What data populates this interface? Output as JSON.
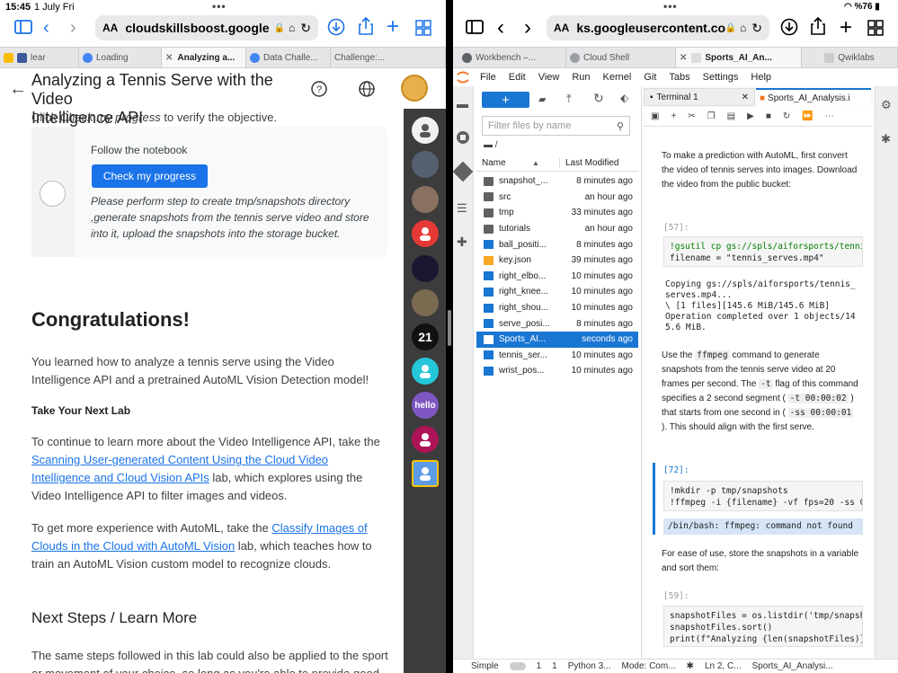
{
  "status": {
    "time": "15:45",
    "date": "1 July Fri",
    "battery": "%76"
  },
  "left": {
    "url": "cloudskillsboost.google",
    "aa": "AA",
    "tabs": [
      "lear",
      "Loading",
      "Analyzing a...",
      "Data Challe...",
      "Challenge:..."
    ],
    "header_title_1": "Analyzing a Tennis Serve with the Video",
    "header_title_2": "Intelligence API",
    "check_progress_line_pre": "Click ",
    "check_progress_line_em": "Check my progress",
    "check_progress_line_post": " to verify the objective.",
    "card_title": "Follow the notebook",
    "check_btn": "Check my progress",
    "card_instructions": "Please perform step to create tmp/snapshots directory ,generate snapshots from the tennis serve video and store into it, upload the snapshots into the storage bucket.",
    "congrats": "Congratulations!",
    "congrats_text": "You learned how to analyze a tennis serve using the Video Intelligence API and a pretrained AutoML Vision Detection model!",
    "next_lab_heading": "Take Your Next Lab",
    "next_lab_pre": "To continue to learn more about the Video Intelligence API, take the ",
    "next_lab_link": "Scanning User-generated Content Using the Cloud Video Intelligence and Cloud Vision APIs",
    "next_lab_post": " lab, which explores using the Video Intelligence API to filter images and videos.",
    "automl_pre": "To get more experience with AutoML, take the ",
    "automl_link": "Classify Images of Clouds in the Cloud with AutoML Vision",
    "automl_post": " lab, which teaches how to train an AutoML Vision custom model to recognize clouds.",
    "next_steps": "Next Steps / Learn More",
    "next_steps_text": "The same steps followed in this lab could also be applied to the sport or movement of your choice, so long as you're able to provide good video",
    "avatar_labels": [
      "21",
      "hello"
    ]
  },
  "right": {
    "url": "ks.googleusercontent.com",
    "aa": "AA",
    "tabs": [
      "Workbench –...",
      "Cloud Shell",
      "Sports_AI_An...",
      "Qwiklabs"
    ],
    "menu": [
      "File",
      "Edit",
      "View",
      "Run",
      "Kernel",
      "Git",
      "Tabs",
      "Settings",
      "Help"
    ],
    "filter_placeholder": "Filter files by name",
    "path": "/",
    "col_name": "Name",
    "col_modified": "Last Modified",
    "files": [
      {
        "name": "snapshot_...",
        "time": "8 minutes ago",
        "type": "folder"
      },
      {
        "name": "src",
        "time": "an hour ago",
        "type": "folder"
      },
      {
        "name": "tmp",
        "time": "33 minutes ago",
        "type": "folder"
      },
      {
        "name": "tutorials",
        "time": "an hour ago",
        "type": "folder"
      },
      {
        "name": "ball_positi...",
        "time": "8 minutes ago",
        "type": "image"
      },
      {
        "name": "key.json",
        "time": "39 minutes ago",
        "type": "json"
      },
      {
        "name": "right_elbo...",
        "time": "10 minutes ago",
        "type": "image"
      },
      {
        "name": "right_knee...",
        "time": "10 minutes ago",
        "type": "image"
      },
      {
        "name": "right_shou...",
        "time": "10 minutes ago",
        "type": "image"
      },
      {
        "name": "serve_posi...",
        "time": "8 minutes ago",
        "type": "image"
      },
      {
        "name": "Sports_AI...",
        "time": "seconds ago",
        "type": "notebook"
      },
      {
        "name": "tennis_ser...",
        "time": "10 minutes ago",
        "type": "image"
      },
      {
        "name": "wrist_pos...",
        "time": "10 minutes ago",
        "type": "image"
      }
    ],
    "selected_file": "Sports_AI...",
    "doc_tabs": [
      "Terminal 1",
      "Sports_AI_Analysis.i"
    ],
    "p1": "To make a prediction with AutoML, first convert the video of tennis serves into images. Download the video from the public bucket:",
    "cell57": "[57]:",
    "code57_1": "!gsutil cp gs://spls/aiforsports/tennis_",
    "code57_2": "filename = \"tennis_serves.mp4\"",
    "out57": "Copying gs://spls/aiforsports/tennis_\nserves.mp4...\n\\ [1 files][145.6 MiB/145.6 MiB]\nOperation completed over 1 objects/14\n5.6 MiB.",
    "p2_a": "Use the ",
    "p2_code1": "ffmpeg",
    "p2_b": " command to generate snapshots from the tennis serve video at 20 frames per second. The ",
    "p2_code2": "-t",
    "p2_c": " flag of this command specifies a 2 second segment ( ",
    "p2_code3": "-t 00:00:02",
    "p2_d": " ) that starts from one second in ( ",
    "p2_code4": "-ss 00:00:01",
    "p2_e": " ). This should align with the first serve.",
    "cell72": "[72]:",
    "code72_1": "!mkdir -p tmp/snapshots",
    "code72_2": "!ffmpeg -i {filename} -vf fps=20 -ss 0",
    "err72": "/bin/bash: ffmpeg: command not found",
    "p3": "For ease of use, store the snapshots in a variable and sort them:",
    "cell59": "[59]:",
    "code59_1": "snapshotFiles = os.listdir('tmp/snapsh",
    "code59_2": "snapshotFiles.sort()",
    "code59_3": "print(f\"Analyzing {len(snapshotFiles)}",
    "status_simple": "Simple",
    "status_1": "1",
    "status_2": "1",
    "status_kernel": "Python 3...",
    "status_mode": "Mode: Com...",
    "status_ln": "Ln 2, C...",
    "status_file": "Sports_AI_Analysi..."
  }
}
